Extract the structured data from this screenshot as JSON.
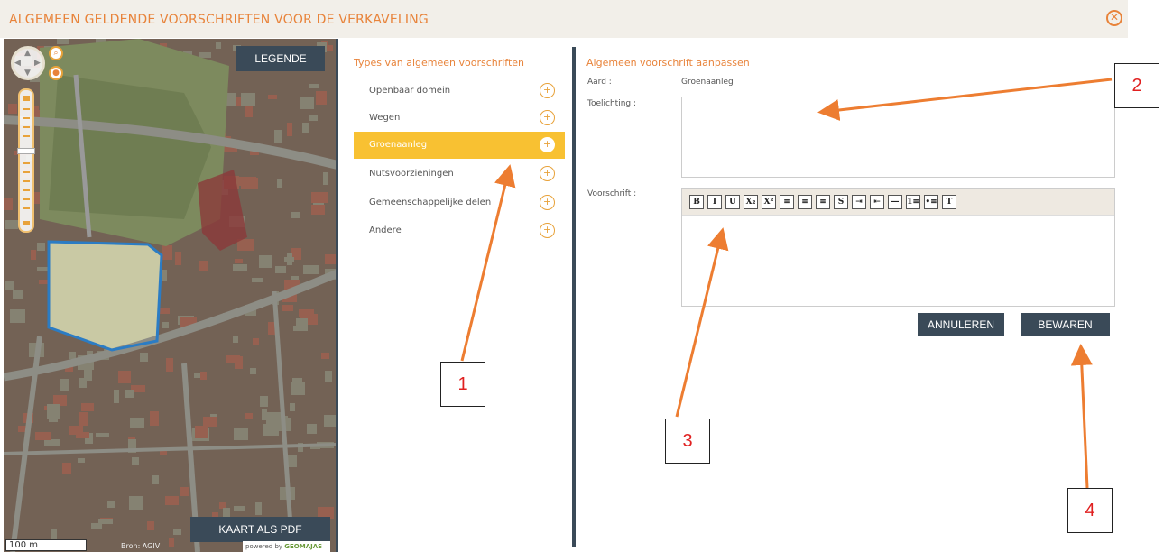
{
  "window": {
    "title": "ALGEMEEN GELDENDE VOORSCHRIFTEN VOOR DE VERKAVELING",
    "close_icon": "close-circle-icon"
  },
  "map": {
    "legend_label": "LEGENDE",
    "pdf_label": "KAART ALS PDF",
    "scale_label": "100 m",
    "source_label": "Bron: AGIV",
    "powered_prefix": "powered by",
    "powered_brand": "GEOMAJAS"
  },
  "types": {
    "title": "Types van algemeen voorschriften",
    "items": [
      {
        "label": "Openbaar domein",
        "active": false
      },
      {
        "label": "Wegen",
        "active": false
      },
      {
        "label": "Groenaanleg",
        "active": true
      },
      {
        "label": "Nutsvoorzieningen",
        "active": false
      },
      {
        "label": "Gemeenschappelijke delen",
        "active": false
      },
      {
        "label": "Andere",
        "active": false
      }
    ]
  },
  "form": {
    "title": "Algemeen voorschrift aanpassen",
    "aard_label": "Aard :",
    "aard_value": "Groenaanleg",
    "toelichting_label": "Toelichting :",
    "toelichting_value": "",
    "voorschrift_label": "Voorschrift :",
    "voorschrift_value": "",
    "cancel_label": "ANNULEREN",
    "save_label": "BEWAREN",
    "toolbar": [
      "B",
      "I",
      "U",
      "X₂",
      "X²",
      "≡",
      "≡",
      "≡",
      "S",
      "⇥",
      "⇤",
      "—",
      "1≡",
      "•≡",
      "T"
    ]
  },
  "annotations": [
    "1",
    "2",
    "3",
    "4"
  ],
  "colors": {
    "accent": "#e8833a",
    "active_item": "#f8c132",
    "button": "#3a4a58",
    "annotation_text": "#e02020"
  }
}
